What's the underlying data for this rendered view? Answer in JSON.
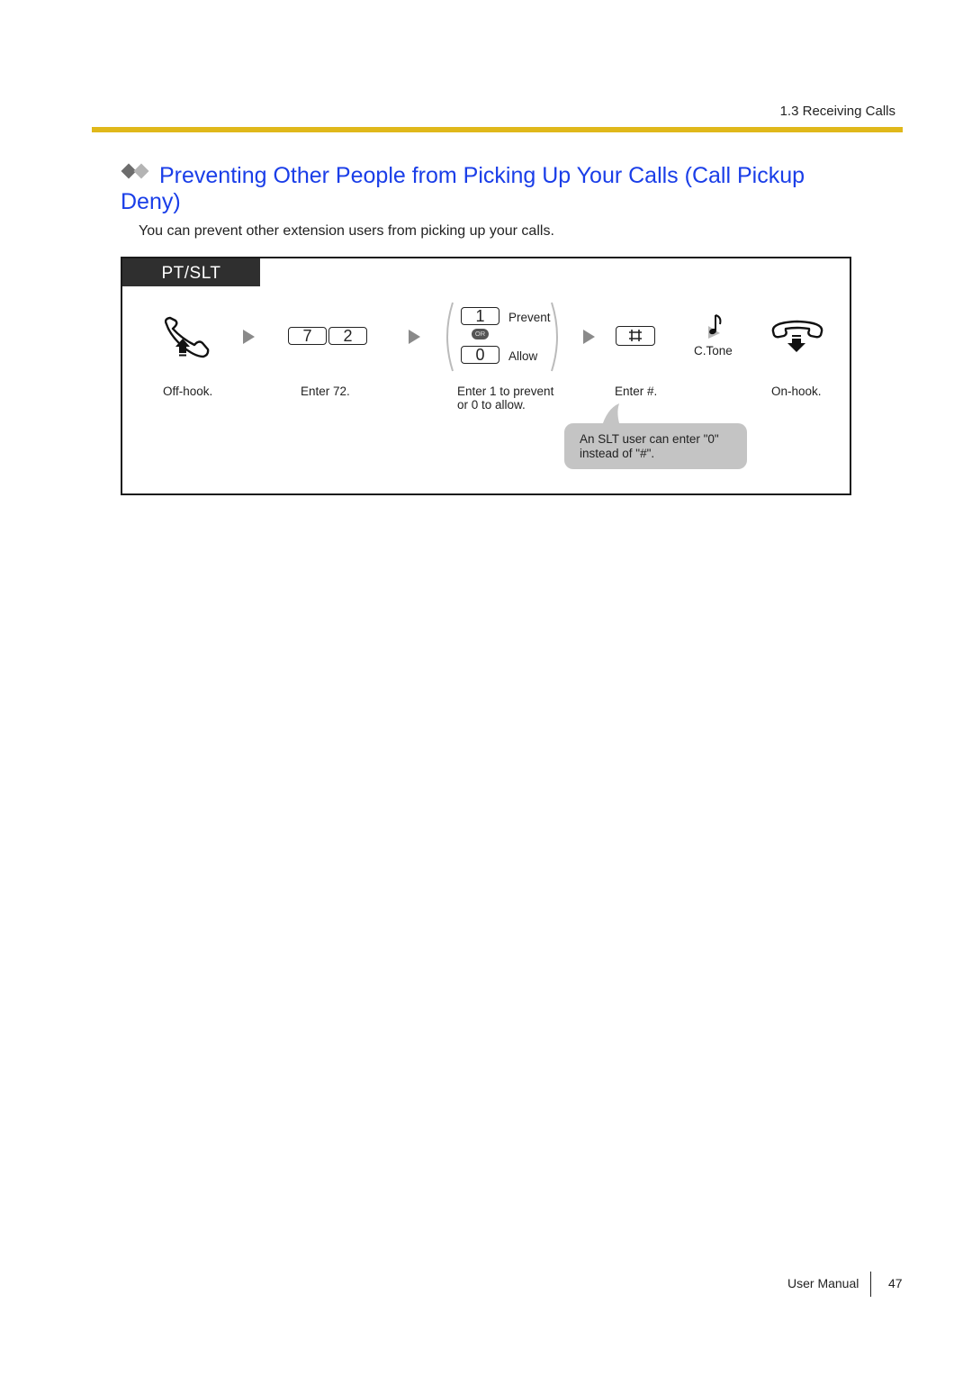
{
  "header": {
    "section": "1.3 Receiving Calls"
  },
  "title": "Preventing Other People from Picking Up Your Calls (Call Pickup Deny)",
  "intro": "You can prevent other extension users from picking up your calls.",
  "colors": {
    "title": "#1a3ee8",
    "rule": "#e0b81a",
    "tag_bg": "#2f2f2f",
    "bubble_bg": "#c4c4c4"
  },
  "procedure": {
    "tag": "PT/SLT",
    "steps": [
      {
        "icon": "off-hook-icon",
        "caption": "Off-hook."
      },
      {
        "keys": [
          "7",
          "2"
        ],
        "caption": "Enter 72."
      },
      {
        "options": [
          {
            "key": "1",
            "label": "Prevent"
          },
          {
            "key": "0",
            "label": "Allow"
          }
        ],
        "or_label": "OR",
        "caption_line1": "Enter 1 to prevent",
        "caption_line2": "or 0 to allow."
      },
      {
        "keys": [
          "#"
        ],
        "caption": "Enter #."
      },
      {
        "icon": "confirmation-tone-icon",
        "label": "C.Tone"
      },
      {
        "icon": "on-hook-icon",
        "caption": "On-hook."
      }
    ],
    "note_line1": "An SLT user can enter \"0\"",
    "note_line2": "instead of \"#\"."
  },
  "footer": {
    "label": "User Manual",
    "page": "47"
  }
}
